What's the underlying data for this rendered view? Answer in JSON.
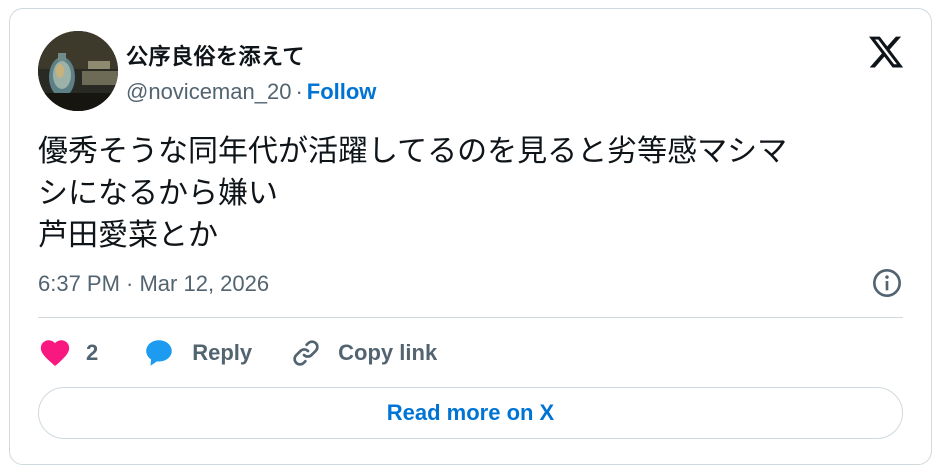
{
  "author": {
    "display_name": "公序良俗を添えて",
    "handle": "@noviceman_20",
    "separator": "·",
    "follow_label": "Follow"
  },
  "logo_icon": "x-logo-icon",
  "tweet": {
    "text": "優秀そうな同年代が活躍してるのを見ると劣等感マシマ\nシになるから嫌い\n芦田愛菜とか",
    "timestamp": "6:37 PM · Mar 12, 2026"
  },
  "actions": {
    "like_count": "2",
    "reply_label": "Reply",
    "copy_link_label": "Copy link"
  },
  "read_more_label": "Read more on X",
  "colors": {
    "link": "#0074d4",
    "heart": "#f91880",
    "reply_bubble": "#1d9bf0",
    "text": "#0f1419",
    "muted": "#536471",
    "border": "#cfd9de"
  }
}
